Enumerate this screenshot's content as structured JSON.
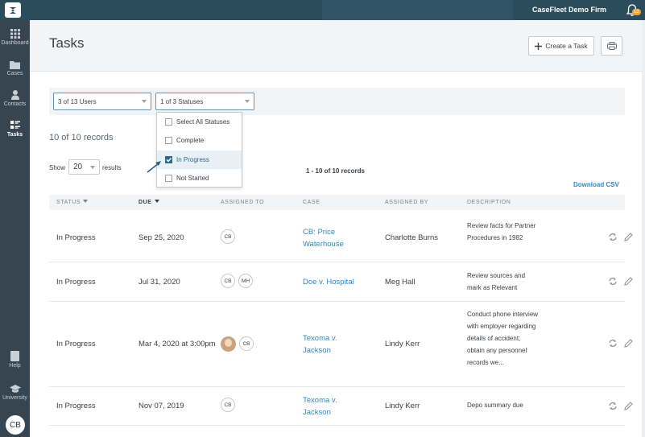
{
  "app": {
    "firm_name": "CaseFleet Demo Firm",
    "notification_count": "12"
  },
  "sidebar": {
    "items": [
      {
        "label": "Dashboard"
      },
      {
        "label": "Cases"
      },
      {
        "label": "Contacts"
      },
      {
        "label": "Tasks"
      }
    ],
    "bottom": [
      {
        "label": "Help"
      },
      {
        "label": "University"
      }
    ],
    "user_initials": "CB"
  },
  "page": {
    "title": "Tasks",
    "create_label": "Create a Task"
  },
  "filters": {
    "users": "3 of 13 Users",
    "statuses": "1 of 3 Statuses",
    "status_options": [
      {
        "label": "Select All Statuses",
        "checked": false
      },
      {
        "label": "Complete",
        "checked": false
      },
      {
        "label": "In Progress",
        "checked": true
      },
      {
        "label": "Not Started",
        "checked": false
      }
    ]
  },
  "summary": {
    "records": "10 of 10 records",
    "show_label": "Show",
    "page_size": "20",
    "results_label": "results",
    "range": "1 - 10 of 10 records",
    "download": "Download CSV"
  },
  "table": {
    "headers": [
      "STATUS",
      "DUE",
      "ASSIGNED TO",
      "CASE",
      "ASSIGNED BY",
      "DESCRIPTION"
    ],
    "rows": [
      {
        "status": "In Progress",
        "due": "Sep 25, 2020",
        "assigned": [
          "CB"
        ],
        "case": "CB: Price Waterhouse",
        "by": "Charlotte Burns",
        "desc": "Review facts for Partner Procedures in 1982"
      },
      {
        "status": "In Progress",
        "due": "Jul 31, 2020",
        "assigned": [
          "CB",
          "MH"
        ],
        "case": "Doe v. Hospital",
        "by": "Meg Hall",
        "desc": "Review sources and mark as Relevant"
      },
      {
        "status": "In Progress",
        "due": "Mar 4, 2020 at 3:00pm",
        "assigned": [
          "photo",
          "CB"
        ],
        "case": "Texoma v. Jackson",
        "by": "Lindy Kerr",
        "desc": "Conduct phone interview with employer regarding details of accident; obtain any personnel records we..."
      },
      {
        "status": "In Progress",
        "due": "Nov 07, 2019",
        "assigned": [
          "CB"
        ],
        "case": "Texoma v. Jackson",
        "by": "Lindy Kerr",
        "desc": "Depo summary due"
      }
    ]
  },
  "colors": {
    "topbar": "#2b4d5b",
    "sidebar": "#36454f",
    "link": "#2b8ac4",
    "accent": "#2b6a8a"
  }
}
